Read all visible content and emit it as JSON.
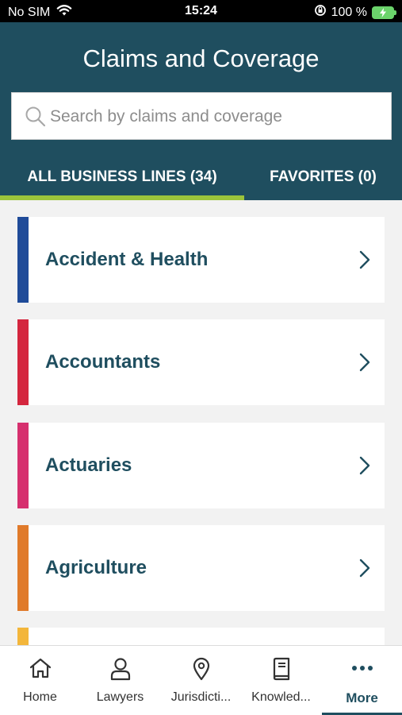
{
  "status_bar": {
    "carrier": "No SIM",
    "time": "15:24",
    "battery": "100 %"
  },
  "header": {
    "title": "Claims and Coverage"
  },
  "search": {
    "placeholder": "Search by claims and coverage"
  },
  "tabs": [
    {
      "label": "ALL BUSINESS LINES (34)",
      "active": true
    },
    {
      "label": "FAVORITES (0)",
      "active": false
    }
  ],
  "colors": {
    "header_bg": "#1f4e5f",
    "tab_indicator": "#9bc43b",
    "label_text": "#1f4e5f"
  },
  "items": [
    {
      "label": "Accident & Health",
      "color": "#1f4b99"
    },
    {
      "label": "Accountants",
      "color": "#d4263e"
    },
    {
      "label": "Actuaries",
      "color": "#d6306e"
    },
    {
      "label": "Agriculture",
      "color": "#e07a2a"
    },
    {
      "label": "",
      "color": "#f3b63b"
    }
  ],
  "tab_bar": [
    {
      "label": "Home",
      "icon": "home-icon"
    },
    {
      "label": "Lawyers",
      "icon": "person-icon"
    },
    {
      "label": "Jurisdicti...",
      "icon": "location-pin-icon"
    },
    {
      "label": "Knowled...",
      "icon": "book-icon"
    },
    {
      "label": "More",
      "icon": "more-icon",
      "active": true
    }
  ]
}
